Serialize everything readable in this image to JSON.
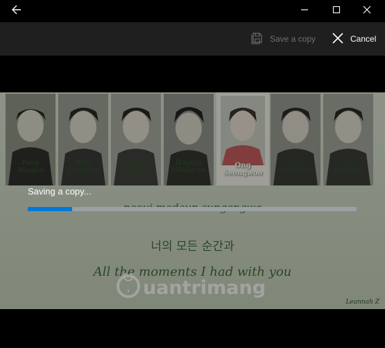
{
  "window": {
    "icons": {
      "back": "back-arrow-icon",
      "minimize": "minimize-icon",
      "maximize": "maximize-icon",
      "close": "close-icon"
    }
  },
  "toolbar": {
    "save_label": "Save a copy",
    "cancel_label": "Cancel",
    "save_icon": "save-icon",
    "cancel_icon": "cancel-x-icon"
  },
  "image": {
    "names": [
      {
        "first": "Park",
        "last": "Woojin"
      },
      {
        "first": "Kim",
        "last": "Jaehwan"
      },
      {
        "first": "Kim",
        "last": "Jonghyun"
      },
      {
        "first": "Hwang",
        "last": "Minhyun"
      },
      {
        "first": "Ong",
        "last": "Seongwoo"
      },
      {
        "first": "Lai",
        "last": "Guanlin"
      },
      {
        "first": "Lee",
        "last": "Daehwi"
      }
    ],
    "lyric_romanized": "neoui modeun sungangwa",
    "lyric_korean": "너의 모든 순간과",
    "lyric_english": "All the moments I had with you",
    "watermark": "Quantrimang",
    "signature": "Leannah Z"
  },
  "progress": {
    "label": "Saving a copy...",
    "fraction": 0.135
  },
  "colors": {
    "accent": "#0078d7",
    "toolbar_bg": "#1f1f1f",
    "lyric_green": "#3f6b3b"
  }
}
